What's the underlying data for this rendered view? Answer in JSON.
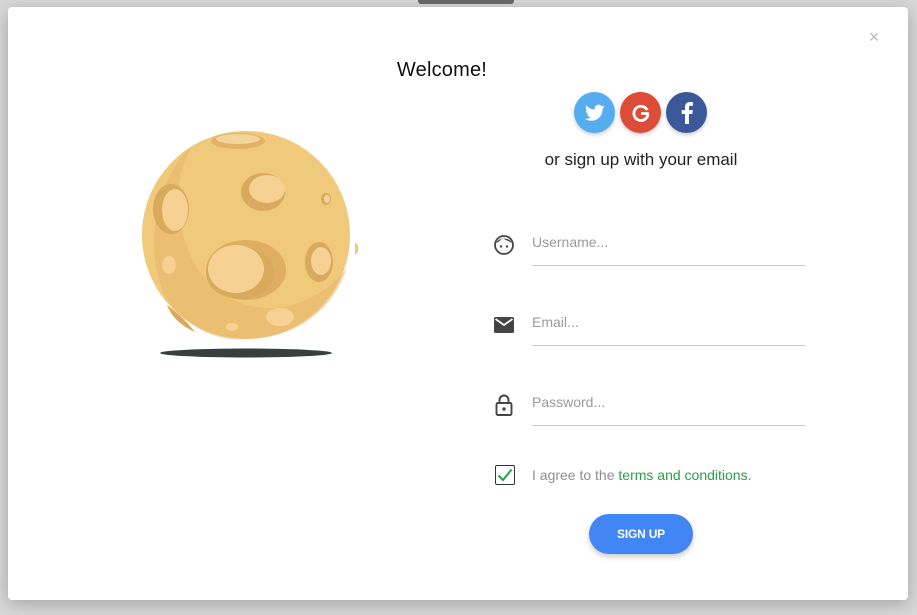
{
  "modal": {
    "close_label": "×",
    "title": "Welcome!"
  },
  "social": {
    "or_text": "or sign up with your email",
    "buttons": [
      {
        "name": "twitter",
        "icon": "twitter-icon",
        "color": "#55acee"
      },
      {
        "name": "google",
        "icon": "google-icon",
        "color": "#dd4b39"
      },
      {
        "name": "facebook",
        "icon": "facebook-icon",
        "color": "#3b5998"
      }
    ]
  },
  "form": {
    "username": {
      "placeholder": "Username...",
      "value": "",
      "icon": "face-icon"
    },
    "email": {
      "placeholder": "Email...",
      "value": "",
      "icon": "mail-icon"
    },
    "password": {
      "placeholder": "Password...",
      "value": "",
      "icon": "lock-icon"
    },
    "agree_prefix": "I agree to the ",
    "agree_link": "terms and conditions.",
    "agree_checked": true,
    "submit_label": "SIGN UP"
  },
  "colors": {
    "accent": "#4285f4",
    "link": "#27a048",
    "moon": "#f0c97a"
  }
}
